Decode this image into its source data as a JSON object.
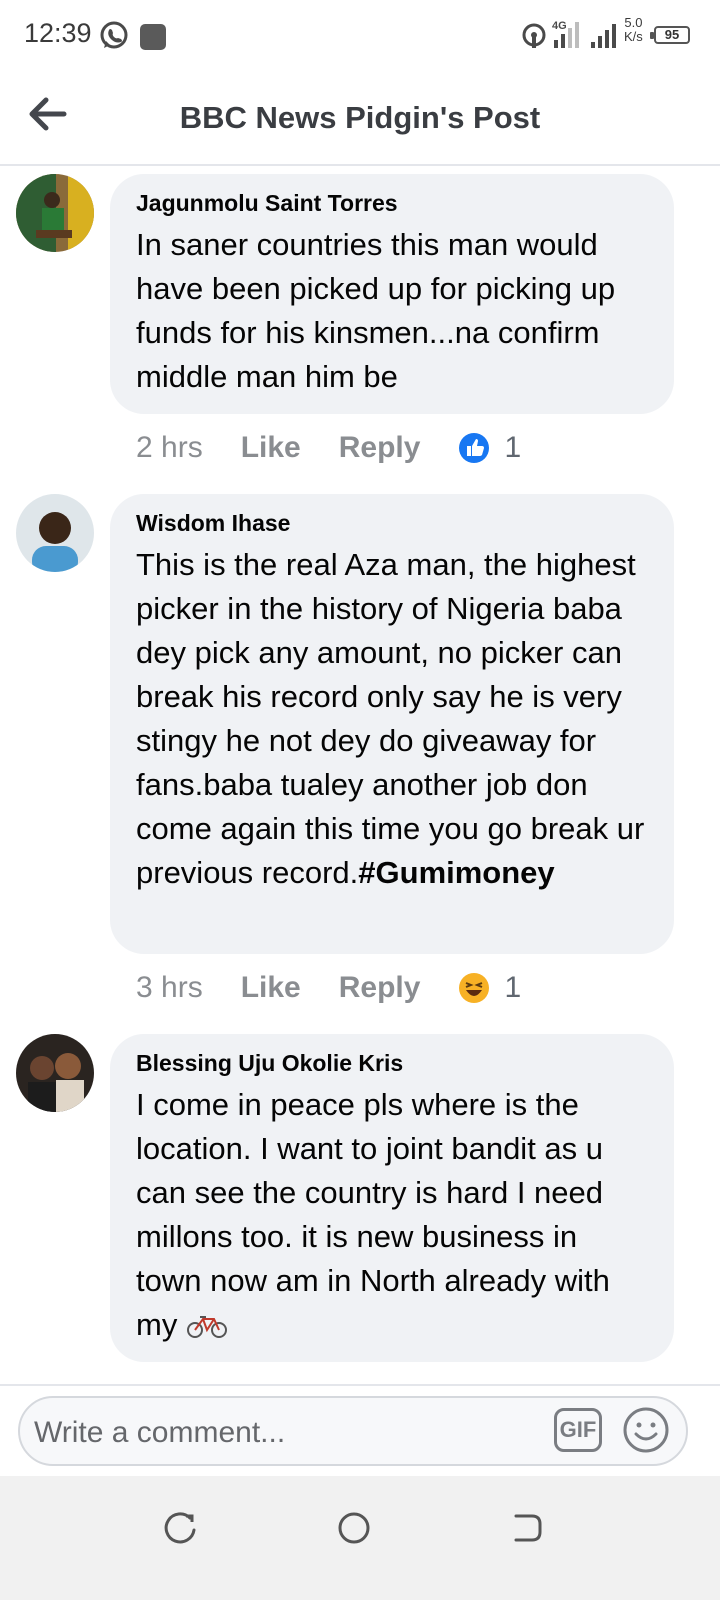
{
  "status_bar": {
    "time": "12:39",
    "network_speed_value": "5.0",
    "network_speed_unit": "K/s",
    "signal_label": "4G",
    "battery": "95"
  },
  "header": {
    "title": "BBC News Pidgin's Post"
  },
  "comments": [
    {
      "author": "Jagunmolu Saint Torres",
      "text": "In saner countries this man would have been picked up for picking up funds for his kinsmen...na confirm middle man him be",
      "time": "2 hrs",
      "like_label": "Like",
      "reply_label": "Reply",
      "reaction": "like-icon",
      "reaction_count": "1"
    },
    {
      "author": "Wisdom Ihase",
      "text": "This is the real Aza man, the highest picker in the history of Nigeria baba dey pick any amount, no picker can break his record only say he is very stingy he not dey do giveaway for fans.baba tualey another job don come again this time you go break ur previous record.",
      "hashtag": "#Gumimoney",
      "time": "3 hrs",
      "like_label": "Like",
      "reply_label": "Reply",
      "reaction": "haha-icon",
      "reaction_count": "1"
    },
    {
      "author": "Blessing Uju Okolie Kris",
      "text": "I come in peace pls where is the location. I want to joint bandit as u can see the country is hard I need millons too. it is new business in town now am in North already with my",
      "emoji": "bicycle-emoji"
    }
  ],
  "composer": {
    "placeholder": "Write a comment...",
    "gif_label": "GIF"
  },
  "colors": {
    "bubble": "#f0f2f5",
    "meta_text": "#8a8d91",
    "like_blue": "#1877f2",
    "haha_yellow": "#f7b125"
  }
}
